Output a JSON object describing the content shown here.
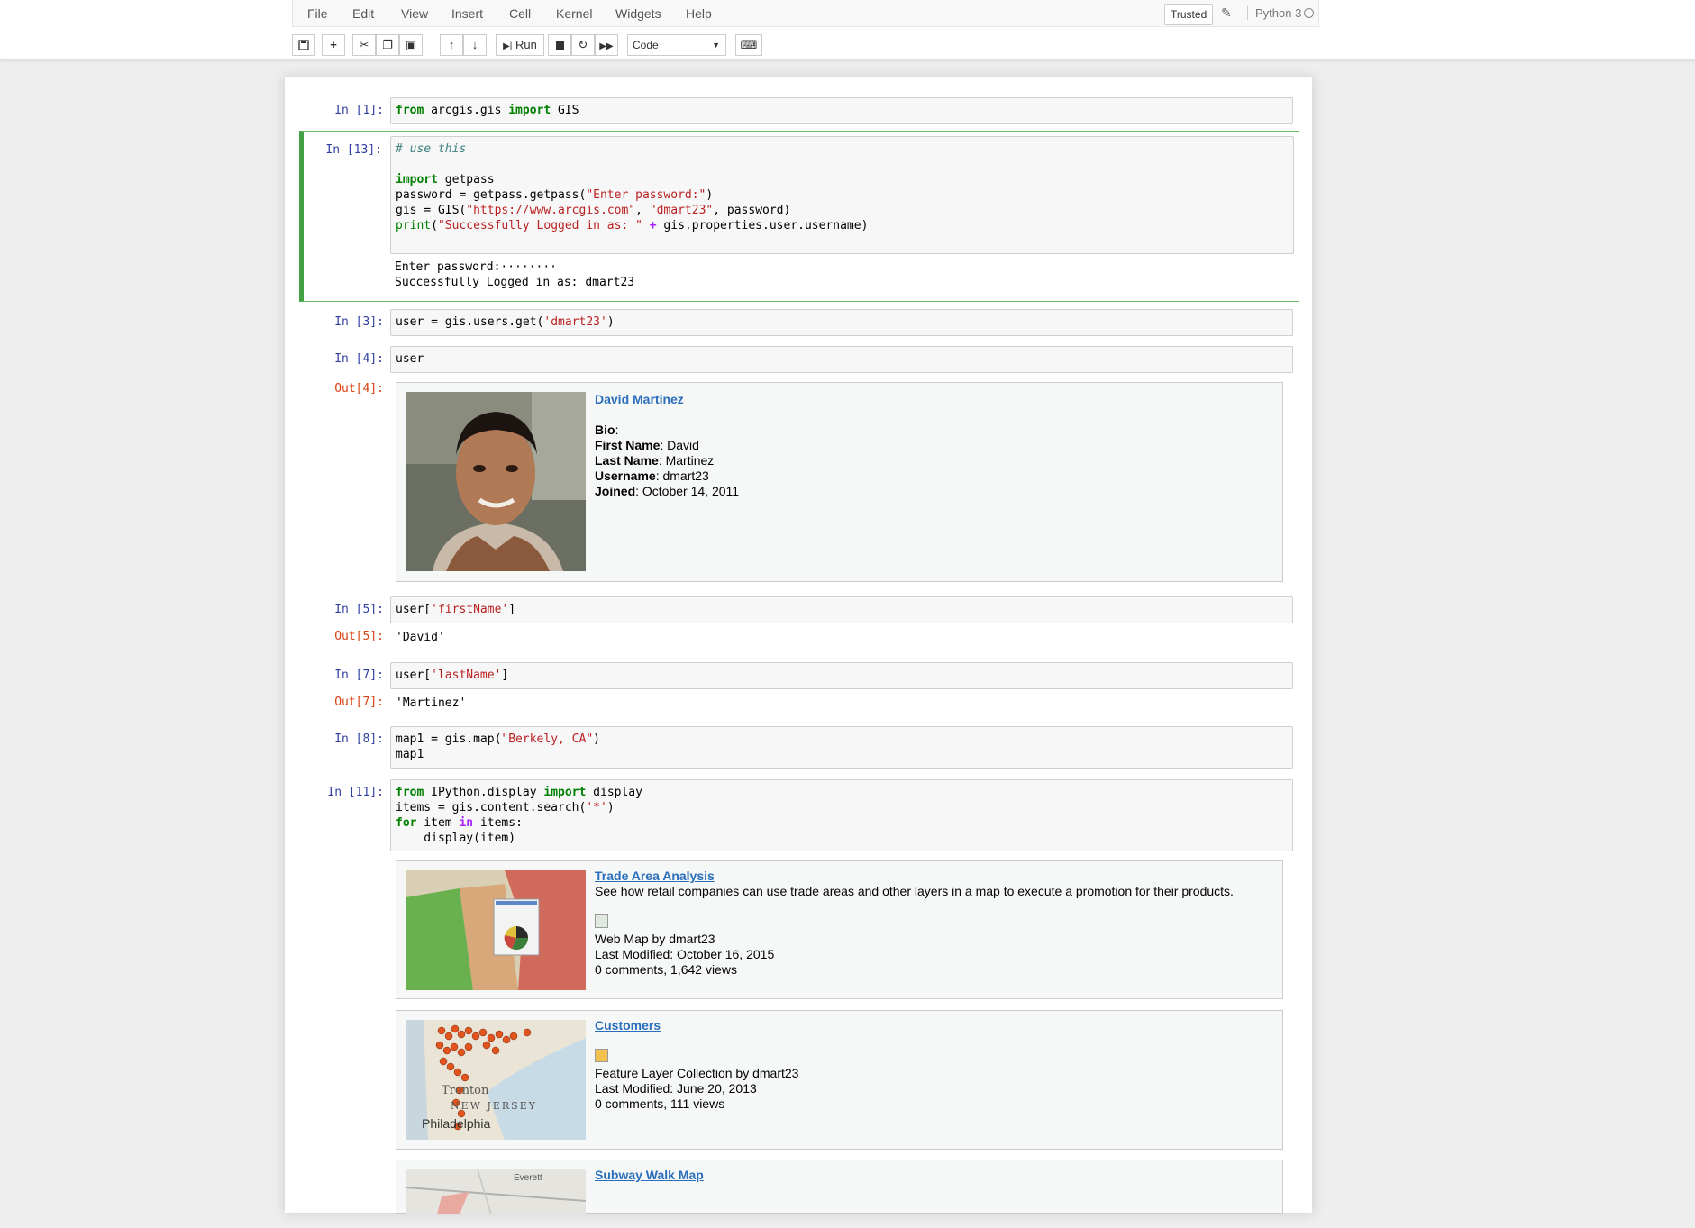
{
  "menubar": {
    "items": [
      "File",
      "Edit",
      "View",
      "Insert",
      "Cell",
      "Kernel",
      "Widgets",
      "Help"
    ],
    "trusted_label": "Trusted",
    "kernel_name": "Python 3"
  },
  "toolbar": {
    "run_label": "Run",
    "cell_type": "Code"
  },
  "cells": {
    "c1": {
      "prompt": "In [1]:"
    },
    "c13": {
      "prompt": "In [13]:",
      "comment": "# use this",
      "output_line1": "Enter password:········",
      "output_line2": "Successfully Logged in as: dmart23"
    },
    "c3": {
      "prompt": "In [3]:"
    },
    "c4": {
      "prompt": "In [4]:",
      "code": "user",
      "out_prompt": "Out[4]:",
      "card": {
        "name": "David Martinez ",
        "bio_label": "Bio",
        "bio_value": ":",
        "first_label": "First Name",
        "first_value": ": David",
        "last_label": "Last Name",
        "last_value": ": Martinez",
        "username_label": "Username",
        "username_value": ": dmart23",
        "joined_label": "Joined",
        "joined_value": ": October 14, 2011"
      }
    },
    "c5": {
      "prompt": "In [5]:",
      "out_prompt": "Out[5]:",
      "out_text": "'David'"
    },
    "c7": {
      "prompt": "In [7]:",
      "out_prompt": "Out[7]:",
      "out_text": "'Martinez'"
    },
    "c8": {
      "prompt": "In [8]:"
    },
    "c11": {
      "prompt": "In [11]:",
      "items": [
        {
          "title": "Trade Area Analysis ",
          "snippet": "See how retail companies can use trade areas and other layers in a map to execute a promotion for their products.",
          "type": "Web Map by dmart23",
          "modified": "Last Modified: October 16, 2015",
          "stats": "0 comments, 1,642 views"
        },
        {
          "title": "Customers ",
          "type": "Feature Layer Collection by dmart23",
          "modified": "Last Modified: June 20, 2013",
          "stats": "0 comments, 111 views",
          "map_label_1": "Trenton",
          "map_label_2": "NEW JERSEY",
          "map_label_3": "Philadelphia"
        },
        {
          "title": "Subway Walk Map ",
          "map_label_1": "Everett"
        }
      ]
    }
  }
}
